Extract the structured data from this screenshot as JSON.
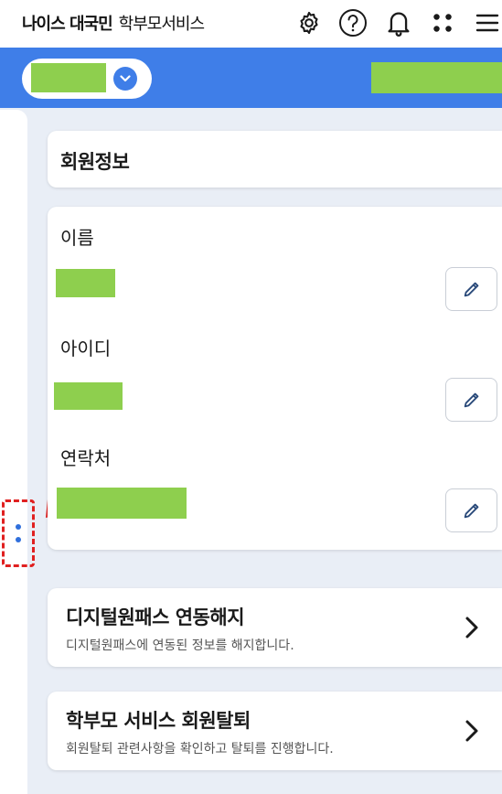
{
  "header": {
    "brand_bold": "나이스 대국민",
    "brand_regular": "학부모서비스",
    "icons": [
      "gear-icon",
      "help-icon",
      "bell-icon",
      "apps-icon",
      "menu-icon"
    ]
  },
  "colors": {
    "accent": "#3f7ee8",
    "redaction": "#8ecf4e",
    "highlight": "#e02020"
  },
  "title_card": {
    "title": "회원정보"
  },
  "member_info": {
    "fields": [
      {
        "label": "이름"
      },
      {
        "label": "아이디"
      },
      {
        "label": "연락처"
      }
    ]
  },
  "links": [
    {
      "title": "디지털원패스 연동해지",
      "subtitle": "디지털원패스에 연동된 정보를 해지합니다."
    },
    {
      "title": "학부모 서비스 회원탈퇴",
      "subtitle": "회원탈퇴 관련사항을 확인하고 탈퇴를 진행합니다."
    }
  ]
}
